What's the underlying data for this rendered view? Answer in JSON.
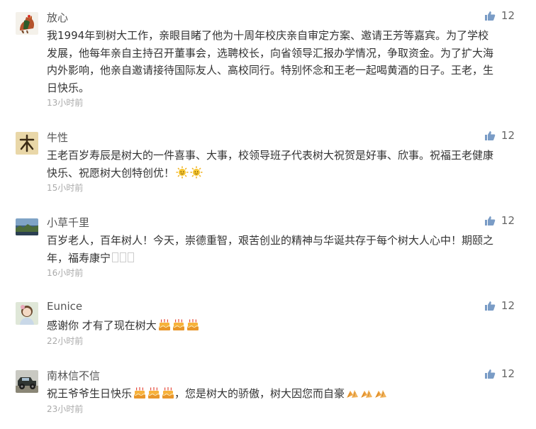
{
  "comments": [
    {
      "user": "放心",
      "avatar_icon": "rooster-icon",
      "text": "我1994年到树大工作，亲眼目睹了他为十周年校庆亲自审定方案、邀请王芳等嘉宾。为了学校发展，他每年亲自主持召开董事会，选聘校长，向省领导汇报办学情况，争取资金。为了扩大海内外影响，他亲自邀请接待国际友人、高校同行。特别怀念和王老一起喝黄酒的日子。王老，生日快乐。",
      "time": "13小时前",
      "likes": "12"
    },
    {
      "user": "牛性",
      "avatar_icon": "calligraphy-icon",
      "text": "王老百岁寿辰是树大的一件喜事、大事，校领导班子代表树大祝贺是好事、欣事。祝福王老健康快乐、祝愿树大创特创优！",
      "time": "15小时前",
      "likes": "12"
    },
    {
      "user": "小草千里",
      "avatar_icon": "landscape-icon",
      "text": "百岁老人，百年树人！今天，崇德重智，艰苦创业的精神与华诞共存于每个树大人心中！期颐之年，福寿康宁",
      "time": "16小时前",
      "likes": "12"
    },
    {
      "user": "Eunice",
      "avatar_icon": "girl-portrait-icon",
      "text": "感谢你 才有了现在树大",
      "time": "22小时前",
      "likes": "12"
    },
    {
      "user": "南林信不信",
      "avatar_icon": "jeep-icon",
      "text_before": "祝王爷爷生日快乐",
      "text_after": "，您是树大的骄傲，树大因您而自豪",
      "time": "23小时前",
      "likes": "12"
    }
  ],
  "colors": {
    "like_icon": "#7a9cc6",
    "time": "#aaaaaa"
  }
}
